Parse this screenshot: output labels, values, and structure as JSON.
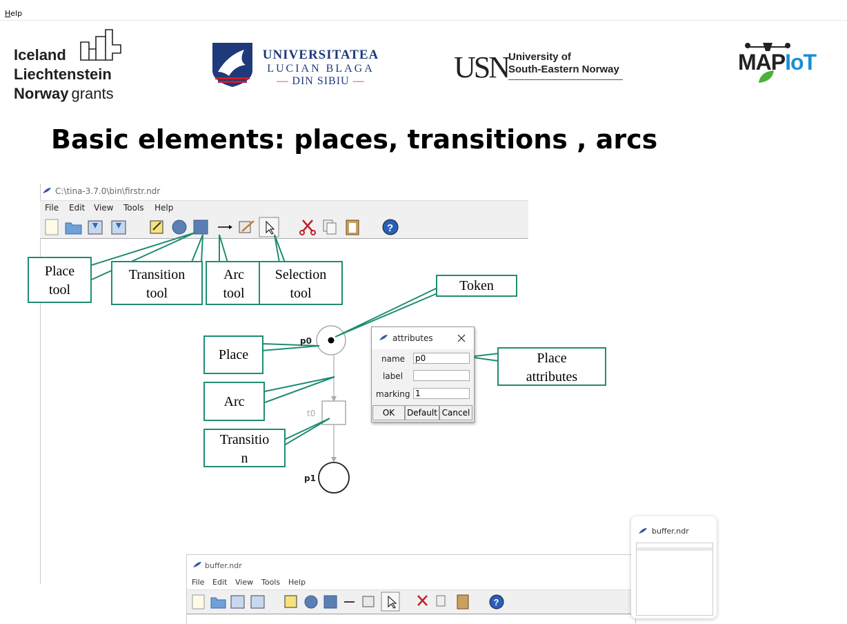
{
  "menubar": {
    "help_label": "Help"
  },
  "logos": {
    "grants": [
      "Iceland",
      "Liechtenstein",
      "Norway",
      "grants"
    ],
    "ulbs": [
      "UNIVERSITATEA",
      "LUCIAN BLAGA",
      "DIN SIBIU"
    ],
    "usn_mark": "USN",
    "usn_text": [
      "University of",
      "South-Eastern Norway"
    ],
    "mapiot": [
      "MAP",
      "IoT"
    ]
  },
  "slide": {
    "title": "Basic elements: places, transitions , arcs"
  },
  "tina": {
    "window_title": "C:\\tina-3.7.0\\bin\\firstr.ndr",
    "menu": [
      "File",
      "Edit",
      "View",
      "Tools",
      "Help"
    ],
    "toolbar_icons": [
      "new-file-icon",
      "open-folder-icon",
      "save-icon",
      "save-as-icon",
      "edit-note-icon",
      "place-tool-icon",
      "transition-tool-icon",
      "arc-tool-icon",
      "edit-tool-icon",
      "selection-tool-icon",
      "cut-icon",
      "copy-icon",
      "paste-icon",
      "help-icon"
    ],
    "nodes": {
      "p0": "p0",
      "t0": "t0",
      "p1": "p1"
    },
    "attributes_dialog": {
      "title": "attributes",
      "name_label": "name",
      "name_value": "p0",
      "label_label": "label",
      "label_value": "",
      "marking_label": "marking",
      "marking_value": "1",
      "ok": "OK",
      "default": "Default",
      "cancel": "Cancel"
    }
  },
  "callouts": {
    "place_tool": [
      "Place",
      "tool"
    ],
    "transition_tool": [
      "Transition",
      "tool"
    ],
    "arc_tool": [
      "Arc",
      "tool"
    ],
    "selection_tool": [
      "Selection",
      "tool"
    ],
    "token": "Token",
    "place": "Place",
    "arc": "Arc",
    "transition": [
      "Transitio",
      "n"
    ],
    "place_attributes": [
      "Place",
      "attributes"
    ]
  },
  "buffer_window": {
    "title": "buffer.ndr",
    "menu": [
      "File",
      "Edit",
      "View",
      "Tools",
      "Help"
    ]
  },
  "thumbnail": {
    "title": "buffer.ndr"
  },
  "colors": {
    "callout_border": "#1e8c73",
    "ulbs_blue": "#1e3a7a",
    "ulbs_red": "#c8202f",
    "mapiot_green": "#4caf3a",
    "mapiot_blue": "#1a8fd6"
  }
}
